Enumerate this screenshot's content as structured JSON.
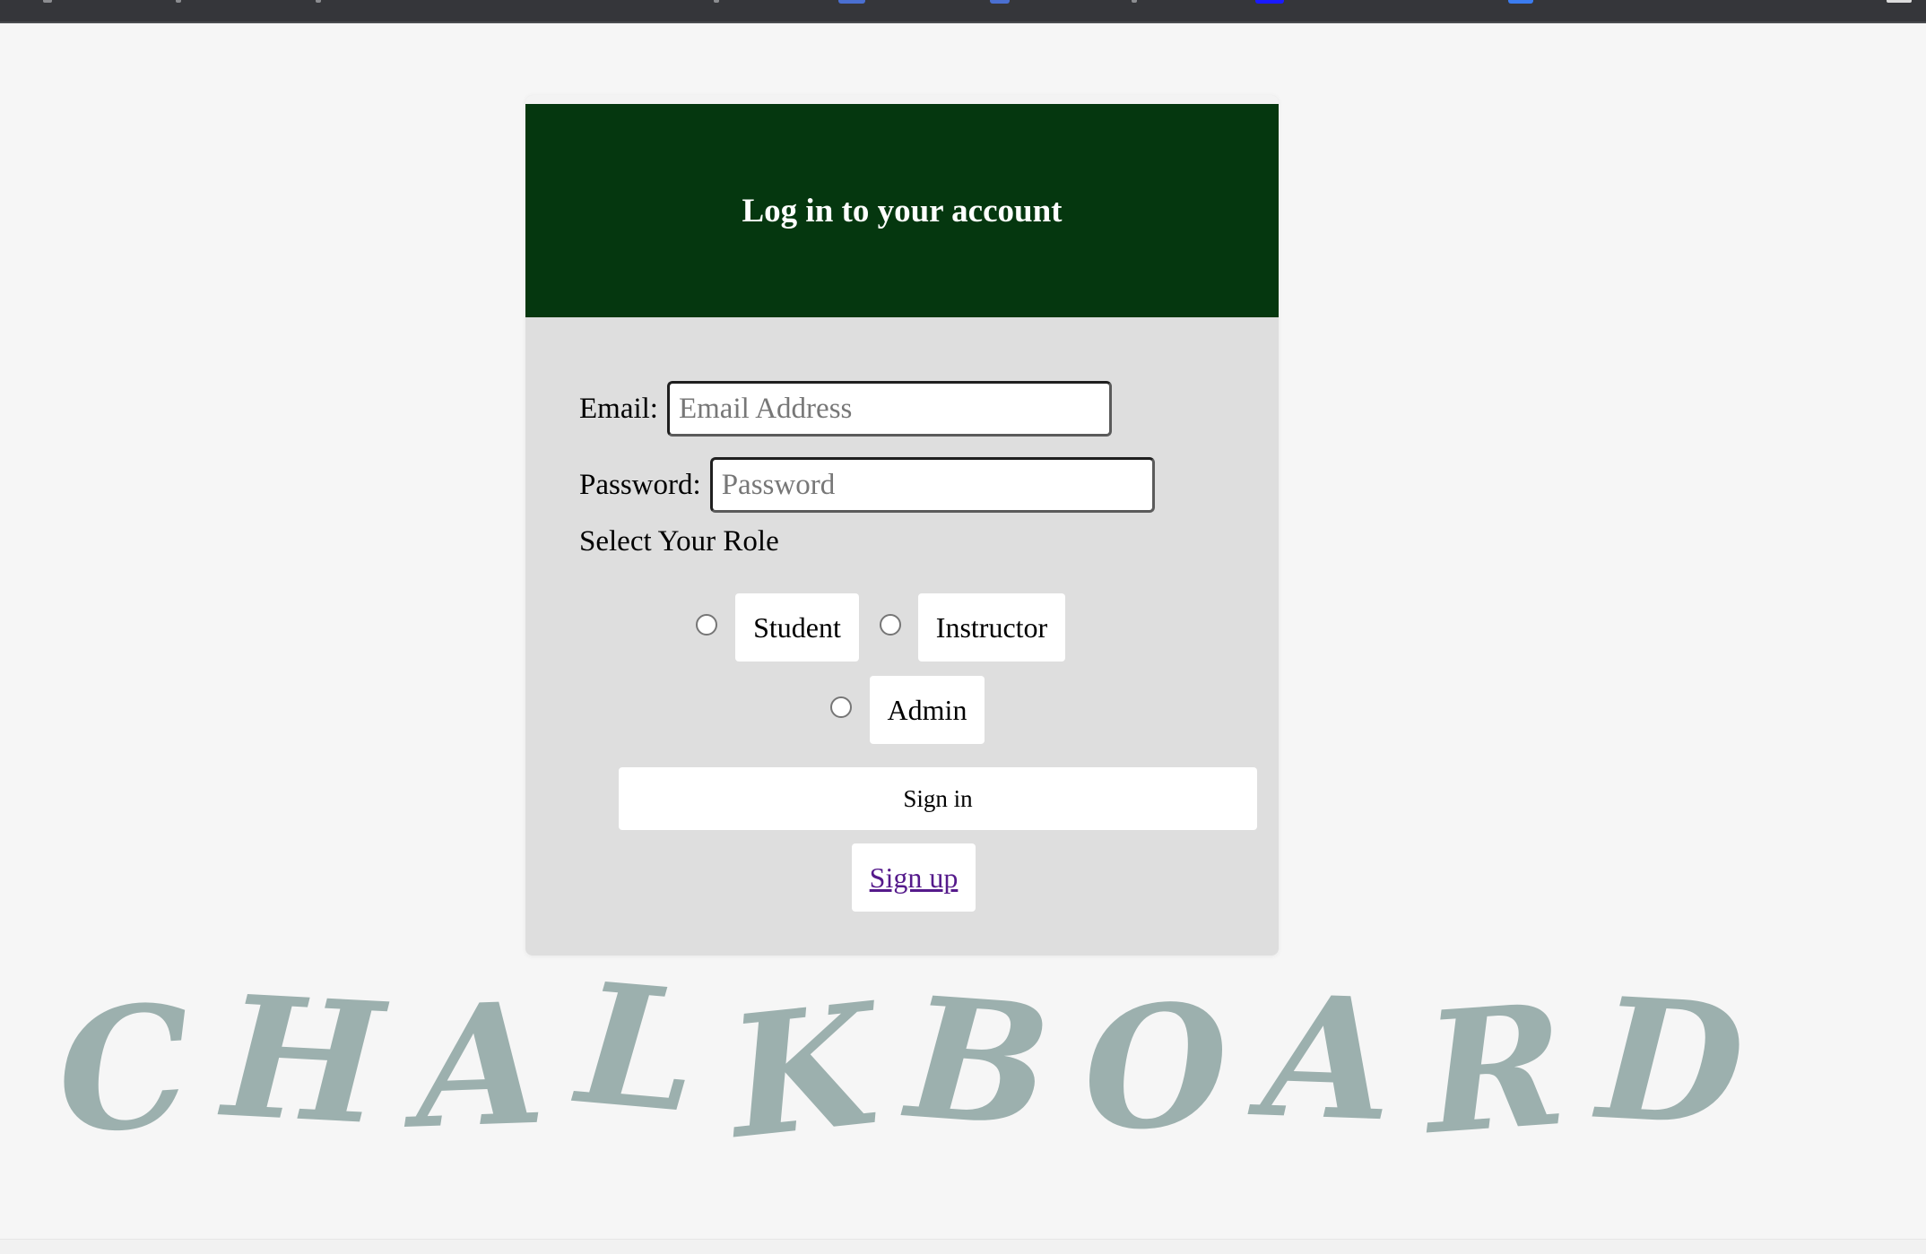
{
  "colors": {
    "page_background": "#f6f6f6",
    "header_background": "#05370f",
    "card_background": "#dedede",
    "link": "#551a8b",
    "brand_text": "#9cb0ae",
    "browser_bar": "#35363a"
  },
  "login": {
    "title": "Log in to your account",
    "email_label": "Email:",
    "email_placeholder": "Email Address",
    "email_value": "",
    "password_label": "Password:",
    "password_placeholder": "Password",
    "password_value": "",
    "role_title": "Select Your Role",
    "roles": [
      {
        "label": "Student",
        "selected": false
      },
      {
        "label": "Instructor",
        "selected": false
      },
      {
        "label": "Admin",
        "selected": false
      }
    ],
    "signin_label": "Sign in",
    "signup_label": "Sign up"
  },
  "brand": {
    "text": "CHALKBOARD"
  }
}
